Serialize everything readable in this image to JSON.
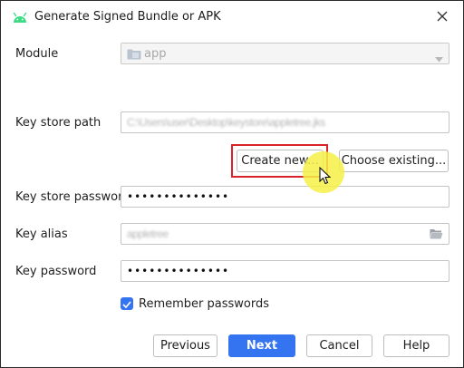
{
  "window": {
    "title": "Generate Signed Bundle or APK",
    "icon": "android-icon",
    "close_icon": "close-icon"
  },
  "module": {
    "label": "Module",
    "value": "app",
    "icon": "module-folder-icon"
  },
  "key_store_path": {
    "label": "Key store path",
    "value": "C:\\Users\\user\\Desktop\\keystore\\appletree.jks"
  },
  "key_store_actions": {
    "create_label": "Create new...",
    "choose_label": "Choose existing..."
  },
  "key_store_password": {
    "label": "Key store password",
    "value": "••••••••••••••"
  },
  "key_alias": {
    "label": "Key alias",
    "value": "appletree",
    "browse_icon": "folder-browse-icon"
  },
  "key_password": {
    "label": "Key password",
    "value": "••••••••••••••"
  },
  "remember": {
    "label": "Remember passwords",
    "checked": true
  },
  "footer": {
    "previous_label": "Previous",
    "next_label": "Next",
    "cancel_label": "Cancel",
    "help_label": "Help"
  },
  "colors": {
    "accent": "#3574f0",
    "highlight_box": "#d8232a",
    "cursor_glow": "#f5f046"
  }
}
